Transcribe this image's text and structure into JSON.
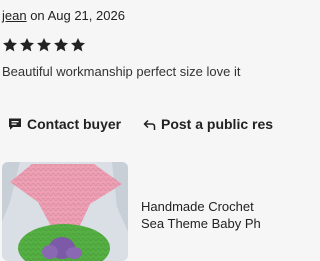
{
  "review": {
    "reviewer": "jean",
    "date_prefix": "on",
    "date": "Aug 21, 2026",
    "rating": 5,
    "rating_max": 5,
    "text": "Beautiful workmanship perfect size love it"
  },
  "actions": {
    "contact_label": "Contact buyer",
    "reply_label": "Post a public res"
  },
  "product": {
    "title_line1": "Handmade Crochet",
    "title_line2": "Sea Theme Baby Ph"
  },
  "colors": {
    "background": "#f6f6f6",
    "text": "#222222",
    "star": "#222222"
  },
  "icons": {
    "contact": "message-bubble-icon",
    "reply": "reply-arrow-icon"
  }
}
